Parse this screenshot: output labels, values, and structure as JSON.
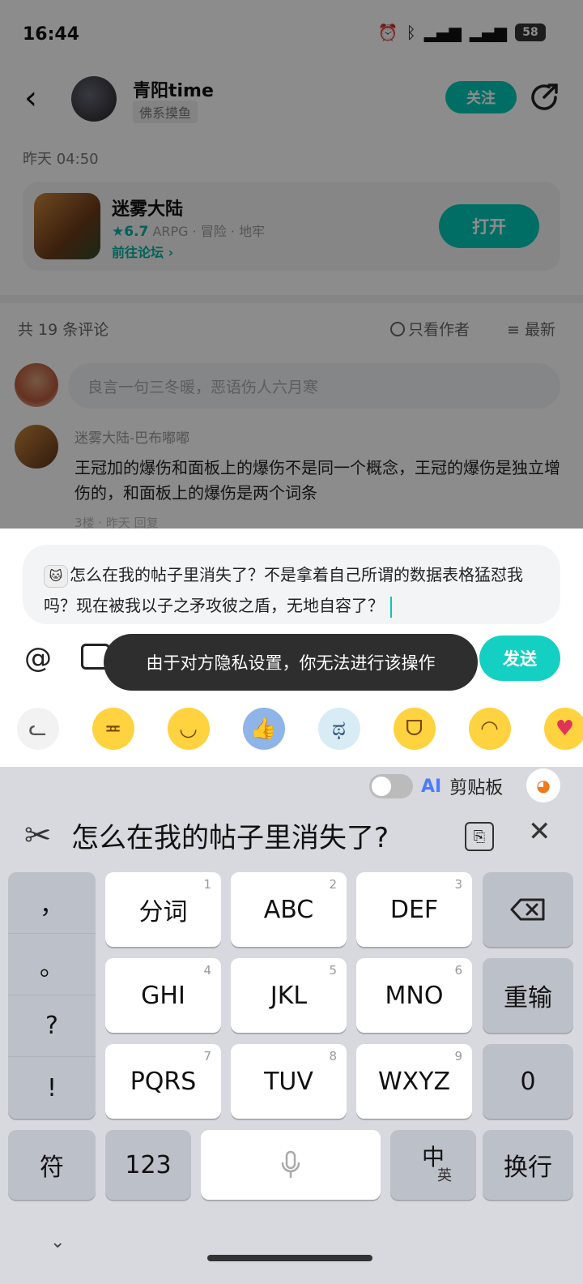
{
  "status": {
    "time": "16:44",
    "battery": "58"
  },
  "post": {
    "back_glyph": "‹",
    "username": "青阳time",
    "user_tag": "佛系摸鱼",
    "follow_label": "关注",
    "date": "昨天 04:50",
    "game": {
      "name": "迷雾大陆",
      "rating": "★6.7",
      "meta": "ARPG · 冒险 · 地牢",
      "forum_link": "前往论坛 ›",
      "open_label": "打开"
    }
  },
  "comments": {
    "count_label": "共 19 条评论",
    "only_author_label": "只看作者",
    "sort_label": "最新",
    "input_placeholder": "良言一句三冬暖，恶语伤人六月寒",
    "first": {
      "author": "迷雾大陆-巴布嘟嘟",
      "text": "王冠加的爆伤和面板上的爆伤不是同一个概念，王冠的爆伤是独立增伤的，和面板上的爆伤是两个词条",
      "footer": "3楼 · 昨天 回复"
    }
  },
  "reply": {
    "text": "怎么在我的帖子里消失了？不是拿着自己所谓的数据表格猛怼我吗？现在被我以子之矛攻彼之盾，无地自容了？",
    "at_symbol": "@",
    "toast": "由于对方隐私设置，你无法进行该操作",
    "send_label": "发送"
  },
  "emoji_row": [
    "cat-face",
    "grimace",
    "smirk",
    "thumbs-up",
    "crying",
    "grin",
    "tongue",
    "heart-smile"
  ],
  "keyboard": {
    "ai_label": "AI",
    "clipboard_label": "剪贴板",
    "clip_text": "怎么在我的帖子里消失了?",
    "punctuation": [
      "，",
      "。",
      "?",
      "!"
    ],
    "keys": [
      {
        "label": "分词",
        "num": "1"
      },
      {
        "label": "ABC",
        "num": "2"
      },
      {
        "label": "DEF",
        "num": "3"
      },
      {
        "label": "GHI",
        "num": "4"
      },
      {
        "label": "JKL",
        "num": "5"
      },
      {
        "label": "MNO",
        "num": "6"
      },
      {
        "label": "PQRS",
        "num": "7"
      },
      {
        "label": "TUV",
        "num": "8"
      },
      {
        "label": "WXYZ",
        "num": "9"
      }
    ],
    "reenter_label": "重输",
    "zero_label": "0",
    "symbol_label": "符",
    "num_label": "123",
    "lang_main": "中",
    "lang_sub": "英",
    "newline_label": "换行"
  }
}
